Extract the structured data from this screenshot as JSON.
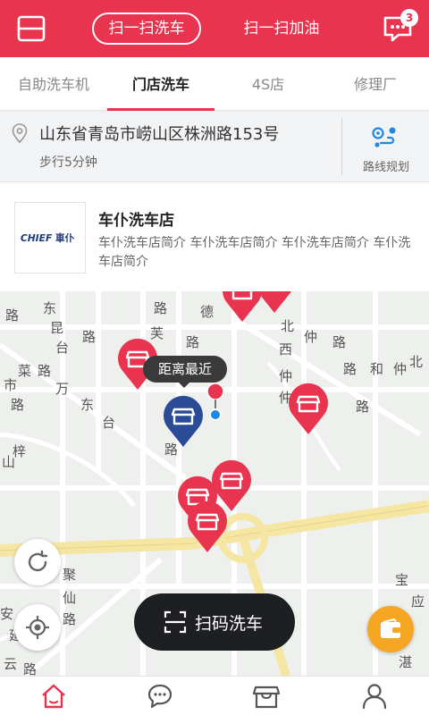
{
  "header": {
    "tab_active": "扫一扫洗车",
    "tab_other": "扫一扫加油",
    "message_badge": "3",
    "accent_color": "#e8344f",
    "icons": {
      "left": "card-icon",
      "right": "message-icon"
    }
  },
  "tabs": [
    {
      "label": "自助洗车机"
    },
    {
      "label": "门店洗车",
      "active": true
    },
    {
      "label": "4S店"
    },
    {
      "label": "修理厂"
    }
  ],
  "address": {
    "text": "山东省青岛市崂山区株洲路153号",
    "walk": "步行5分钟",
    "route_label": "路线规划"
  },
  "store": {
    "logo_text": "CHIEF車仆",
    "name": "车仆洗车店",
    "intro": "车仆洗车店简介 车仆洗车店简介 车仆洗车店简介 车仆洗车店简介"
  },
  "map": {
    "tooltip": "距离最近",
    "scan_button": "扫码洗车",
    "street_labels": [
      {
        "t": "路"
      },
      {
        "t": "东"
      },
      {
        "t": "昆"
      },
      {
        "t": "台"
      },
      {
        "t": "路"
      },
      {
        "t": "菜"
      },
      {
        "t": "路"
      },
      {
        "t": "市"
      },
      {
        "t": "路"
      },
      {
        "t": "万"
      },
      {
        "t": "东"
      },
      {
        "t": "台"
      },
      {
        "t": "梓"
      },
      {
        "t": "山"
      },
      {
        "t": "路"
      },
      {
        "t": "仲"
      },
      {
        "t": "北"
      },
      {
        "t": "西"
      },
      {
        "t": "仲"
      },
      {
        "t": "路"
      },
      {
        "t": "和"
      },
      {
        "t": "仲"
      },
      {
        "t": "北"
      },
      {
        "t": "路"
      },
      {
        "t": "仲"
      },
      {
        "t": "路"
      },
      {
        "t": "聚"
      },
      {
        "t": "仙"
      },
      {
        "t": "路"
      },
      {
        "t": "宝"
      },
      {
        "t": "应"
      },
      {
        "t": "路"
      },
      {
        "t": "湛"
      },
      {
        "t": "延"
      },
      {
        "t": "云"
      },
      {
        "t": "安"
      },
      {
        "t": "路"
      },
      {
        "t": "芙"
      },
      {
        "t": "路"
      },
      {
        "t": "德"
      },
      {
        "t": "路"
      }
    ],
    "pin_colors": {
      "store": "#e8344f",
      "nearest": "#2a4c97",
      "user": "#e8344f"
    }
  },
  "bottom_nav": [
    {
      "icon": "home-icon",
      "active": true
    },
    {
      "icon": "chat-icon"
    },
    {
      "icon": "store-icon"
    },
    {
      "icon": "profile-icon"
    }
  ]
}
